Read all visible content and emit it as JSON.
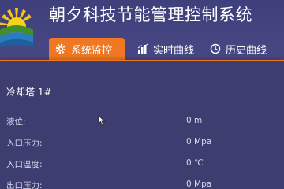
{
  "app": {
    "title": "朝夕科技节能管理控制系统"
  },
  "tabs": [
    {
      "label": "系统监控",
      "icon": "gear-icon",
      "active": true
    },
    {
      "label": "实时曲线",
      "icon": "bar-chart-icon",
      "active": false
    },
    {
      "label": "历史曲线",
      "icon": "clock-icon",
      "active": false
    }
  ],
  "panel": {
    "title": "冷却塔 1#",
    "rows": [
      {
        "label": "液位:",
        "value": "0 m"
      },
      {
        "label": "入口压力:",
        "value": "0 Mpa"
      },
      {
        "label": "入口温度:",
        "value": "0 ℃"
      },
      {
        "label": "出口压力:",
        "value": "0 Mpa"
      }
    ]
  },
  "colors": {
    "accent": "#f07822",
    "background": "#4a4a86",
    "panel": "#3d3e6f"
  }
}
